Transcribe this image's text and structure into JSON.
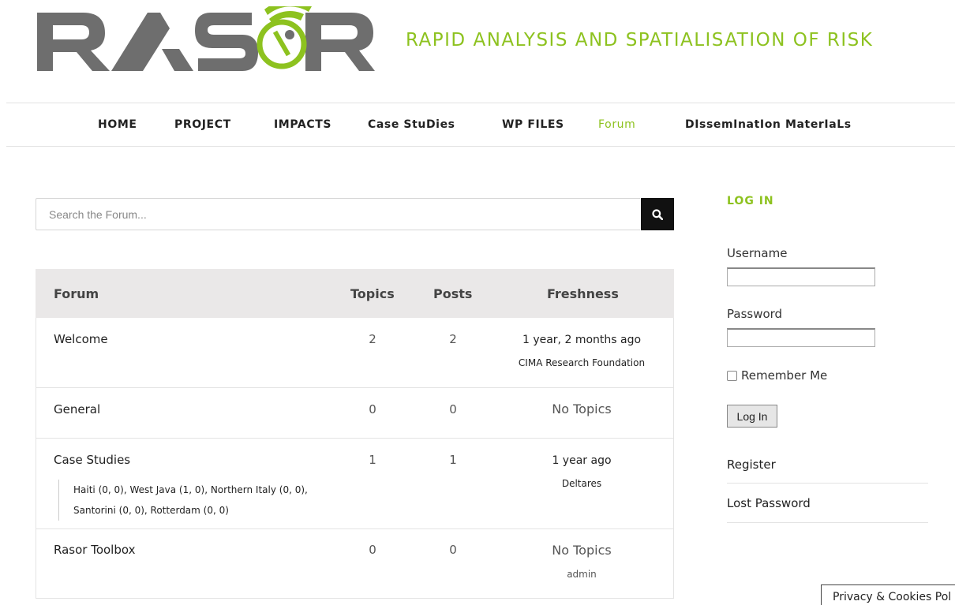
{
  "brand": {
    "logo_text": "RASOR",
    "tagline": "RAPID ANALYSIS AND SPATIALISATION OF RISK",
    "colors": {
      "accent": "#8dc21f",
      "logo_gray": "#6e6e6e"
    }
  },
  "nav": {
    "items": [
      {
        "label": "HOME",
        "active": false
      },
      {
        "label": "PROJECT",
        "active": false
      },
      {
        "label": "IMPACTS",
        "active": false
      },
      {
        "label": "Case StuDies",
        "active": false
      },
      {
        "label": "WP FILES",
        "active": false
      },
      {
        "label": "Forum",
        "active": true
      },
      {
        "label": "DIssemInatIon MaterIaLs",
        "active": false
      }
    ]
  },
  "search": {
    "placeholder": "Search the Forum...",
    "icon": "search-icon"
  },
  "forum_table": {
    "headers": {
      "forum": "Forum",
      "topics": "Topics",
      "posts": "Posts",
      "freshness": "Freshness"
    },
    "rows": [
      {
        "name": "Welcome",
        "topics": "2",
        "posts": "2",
        "freshness": "1 year, 2 months ago",
        "author": "CIMA Research Foundation",
        "subforums": []
      },
      {
        "name": "General",
        "topics": "0",
        "posts": "0",
        "freshness": "No Topics",
        "author": "",
        "subforums": []
      },
      {
        "name": "Case Studies",
        "topics": "1",
        "posts": "1",
        "freshness": "1 year ago",
        "author": "Deltares",
        "subforums_line1": "Haiti (0, 0), West Java (1, 0), Northern Italy (0, 0),",
        "subforums_line2": "Santorini (0, 0), Rotterdam (0, 0)"
      },
      {
        "name": "Rasor Toolbox",
        "topics": "0",
        "posts": "0",
        "freshness": "No Topics",
        "author": "admin",
        "subforums": []
      }
    ]
  },
  "sidebar": {
    "login_title": "LOG IN",
    "username_label": "Username",
    "password_label": "Password",
    "remember_label": "Remember Me",
    "login_button": "Log In",
    "register_link": "Register",
    "lost_password_link": "Lost Password"
  },
  "cookie_notice": "Privacy & Cookies Pol"
}
